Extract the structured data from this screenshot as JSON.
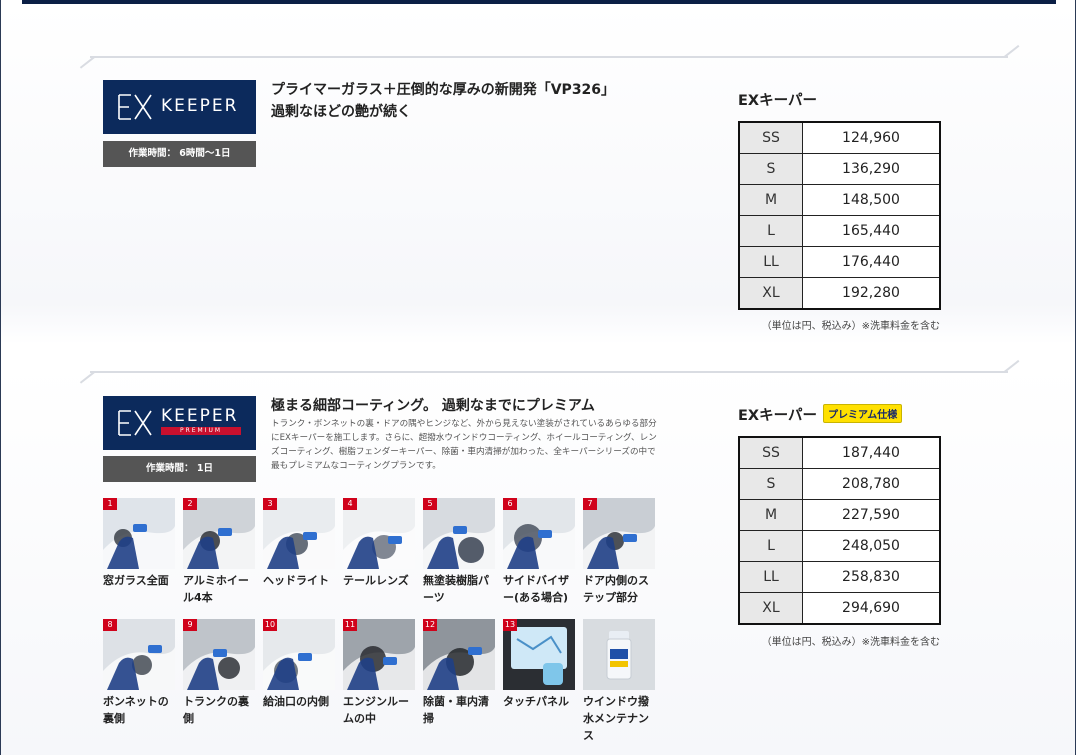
{
  "colors": {
    "navy": "#0c2a5c",
    "premium_red": "#c8102e",
    "badge_yellow": "#ffe000",
    "num_red": "#d0021b"
  },
  "section1": {
    "logo_brand": "KEEPER",
    "worktime": "作業時間： 6時間〜1日",
    "headline_line1": "プライマーガラス＋圧倒的な厚みの新開発「VP326」",
    "headline_line2": "過剰なほどの艶が続く",
    "price_title": "EXキーパー",
    "prices": [
      {
        "size": "SS",
        "price": "124,960"
      },
      {
        "size": "S",
        "price": "136,290"
      },
      {
        "size": "M",
        "price": "148,500"
      },
      {
        "size": "L",
        "price": "165,440"
      },
      {
        "size": "LL",
        "price": "176,440"
      },
      {
        "size": "XL",
        "price": "192,280"
      }
    ],
    "note": "（単位は円、税込み）※洗車料金を含む"
  },
  "section2": {
    "logo_brand": "KEEPER",
    "logo_sub": "PREMIUM",
    "worktime": "作業時間： 1日",
    "headline": "極まる細部コーティング。 過剰なまでにプレミアム",
    "description": "トランク・ボンネットの裏・ドアの隅やヒンジなど、外から見えない塗装がされているあらゆる部分にEXキーパーを施工します。さらに、超撥水ウインドウコーティング、ホイールコーティング、レンズコーティング、樹脂フェンダーキーパー、除菌・車内清掃が加わった、全キーパーシリーズの中で最もプレミアムなコーティングプランです。",
    "price_title": "EXキーパー",
    "badge": "プレミアム仕様",
    "prices": [
      {
        "size": "SS",
        "price": "187,440"
      },
      {
        "size": "S",
        "price": "208,780"
      },
      {
        "size": "M",
        "price": "227,590"
      },
      {
        "size": "L",
        "price": "248,050"
      },
      {
        "size": "LL",
        "price": "258,830"
      },
      {
        "size": "XL",
        "price": "294,690"
      }
    ],
    "note": "（単位は円、税込み）※洗車料金を含む",
    "items": [
      {
        "num": "1",
        "caption": "窓ガラス全面"
      },
      {
        "num": "2",
        "caption": "アルミホイール4本"
      },
      {
        "num": "3",
        "caption": "ヘッドライト"
      },
      {
        "num": "4",
        "caption": "テールレンズ"
      },
      {
        "num": "5",
        "caption": "無塗装樹脂パーツ"
      },
      {
        "num": "6",
        "caption": "サイドバイザー(ある場合)"
      },
      {
        "num": "7",
        "caption": "ドア内側のステップ部分"
      },
      {
        "num": "8",
        "caption": "ボンネットの裏側"
      },
      {
        "num": "9",
        "caption": "トランクの裏側"
      },
      {
        "num": "10",
        "caption": "給油口の内側"
      },
      {
        "num": "11",
        "caption": "エンジンルームの中"
      },
      {
        "num": "12",
        "caption": "除菌・車内清掃"
      },
      {
        "num": "13",
        "caption": "タッチパネル"
      },
      {
        "num": "",
        "caption": "ウインドウ撥水メンテナンス"
      }
    ]
  }
}
